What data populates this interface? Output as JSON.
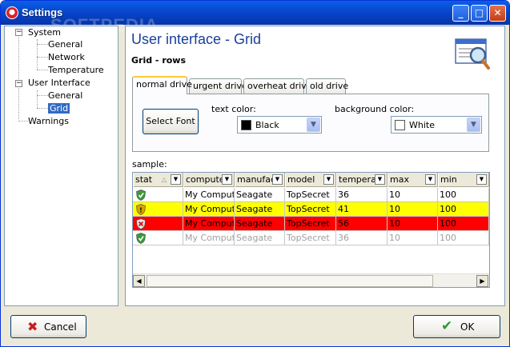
{
  "window": {
    "title": "Settings",
    "watermark": "SOFTPEDIA"
  },
  "titlebar_buttons": {
    "minimize": "_",
    "maximize": "□",
    "close": "✕"
  },
  "tree": {
    "system": "System",
    "system_general": "General",
    "system_network": "Network",
    "system_temperature": "Temperature",
    "user_interface": "User Interface",
    "ui_general": "General",
    "ui_grid": "Grid",
    "warnings": "Warnings"
  },
  "main": {
    "title": "User interface - Grid",
    "subtitle": "Grid - rows"
  },
  "tabs": [
    "normal drive",
    "urgent drive",
    "overheat drive",
    "old drive"
  ],
  "panel": {
    "select_font": "Select Font",
    "text_color_label": "text color:",
    "text_color_value": "Black",
    "text_color_swatch": "#000000",
    "bg_color_label": "background color:",
    "bg_color_value": "White",
    "bg_color_swatch": "#ffffff"
  },
  "sample_label": "sample:",
  "grid": {
    "columns": [
      "stat",
      "compute",
      "manufac",
      "model",
      "temperat",
      "max",
      "min"
    ],
    "rows": [
      {
        "status": "ok",
        "cells": [
          "My Compute",
          "Seagate",
          "TopSecret",
          "36",
          "10",
          "100"
        ],
        "bg": "#ffffff",
        "fg": "#000000"
      },
      {
        "status": "warning",
        "cells": [
          "My Compute",
          "Seagate",
          "TopSecret",
          "41",
          "10",
          "100"
        ],
        "bg": "#ffff00",
        "fg": "#000000"
      },
      {
        "status": "critical",
        "cells": [
          "My Compute",
          "Seagate",
          "TopSecret",
          "56",
          "10",
          "100"
        ],
        "bg": "#ff0000",
        "fg": "#000000"
      },
      {
        "status": "ok",
        "cells": [
          "My Compute",
          "Seagate",
          "TopSecret",
          "36",
          "10",
          "100"
        ],
        "bg": "#ffffff",
        "fg": "#a0a0a0"
      }
    ]
  },
  "footer": {
    "cancel": "Cancel",
    "ok": "OK"
  },
  "colors": {
    "accent": "#1a3f9b",
    "selection": "#316ac5",
    "titlebar": "#0742c6"
  }
}
